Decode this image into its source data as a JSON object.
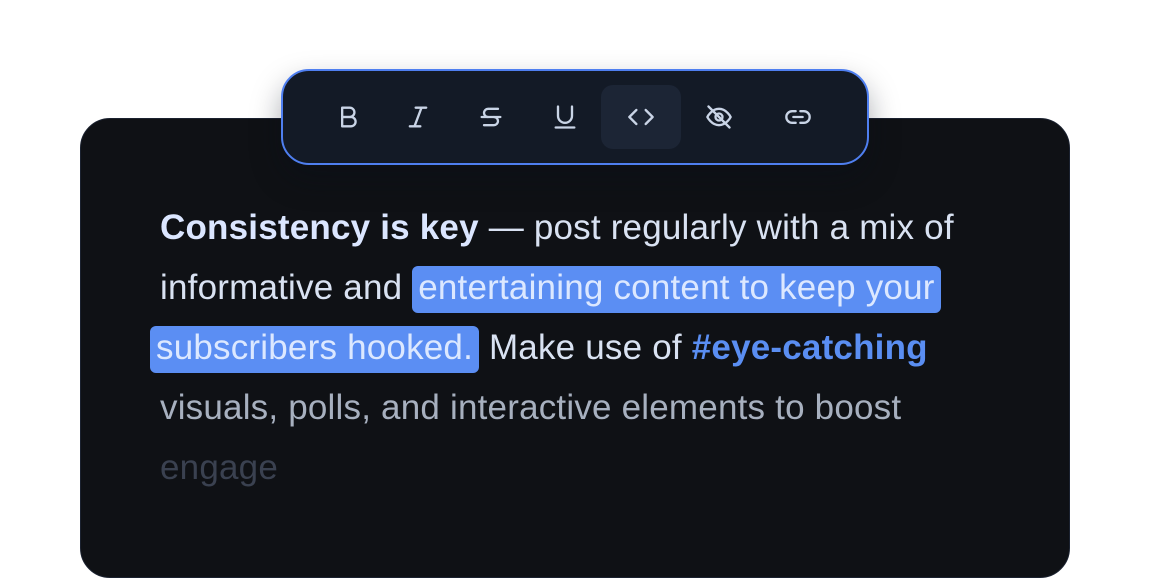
{
  "toolbar": {
    "buttons": [
      {
        "name": "bold",
        "icon": "bold-icon",
        "active": false
      },
      {
        "name": "italic",
        "icon": "italic-icon",
        "active": false
      },
      {
        "name": "strikethrough",
        "icon": "strikethrough-icon",
        "active": false
      },
      {
        "name": "underline",
        "icon": "underline-icon",
        "active": false
      },
      {
        "name": "code",
        "icon": "code-icon",
        "active": true
      },
      {
        "name": "hide",
        "icon": "eye-off-icon",
        "active": false
      },
      {
        "name": "link",
        "icon": "link-icon",
        "active": false
      }
    ]
  },
  "content": {
    "line1": {
      "bold": "Consistency is key",
      "rest": " — post regularly with a mix of"
    },
    "line2": {
      "plain": "informative and ",
      "selected": "entertaining content to keep your"
    },
    "line3": {
      "selected": "subscribers hooked.",
      "plain": " Make use of ",
      "hashtag": "#eye-catching"
    },
    "line4": "visuals, polls, and interactive elements to boost",
    "line5": "engage"
  },
  "colors": {
    "accent": "#4f7ff0",
    "selection": "#5b8ef3",
    "hashtag": "#5a8ef2",
    "editor_background": "#0f1115",
    "toolbar_background": "#131a26"
  }
}
